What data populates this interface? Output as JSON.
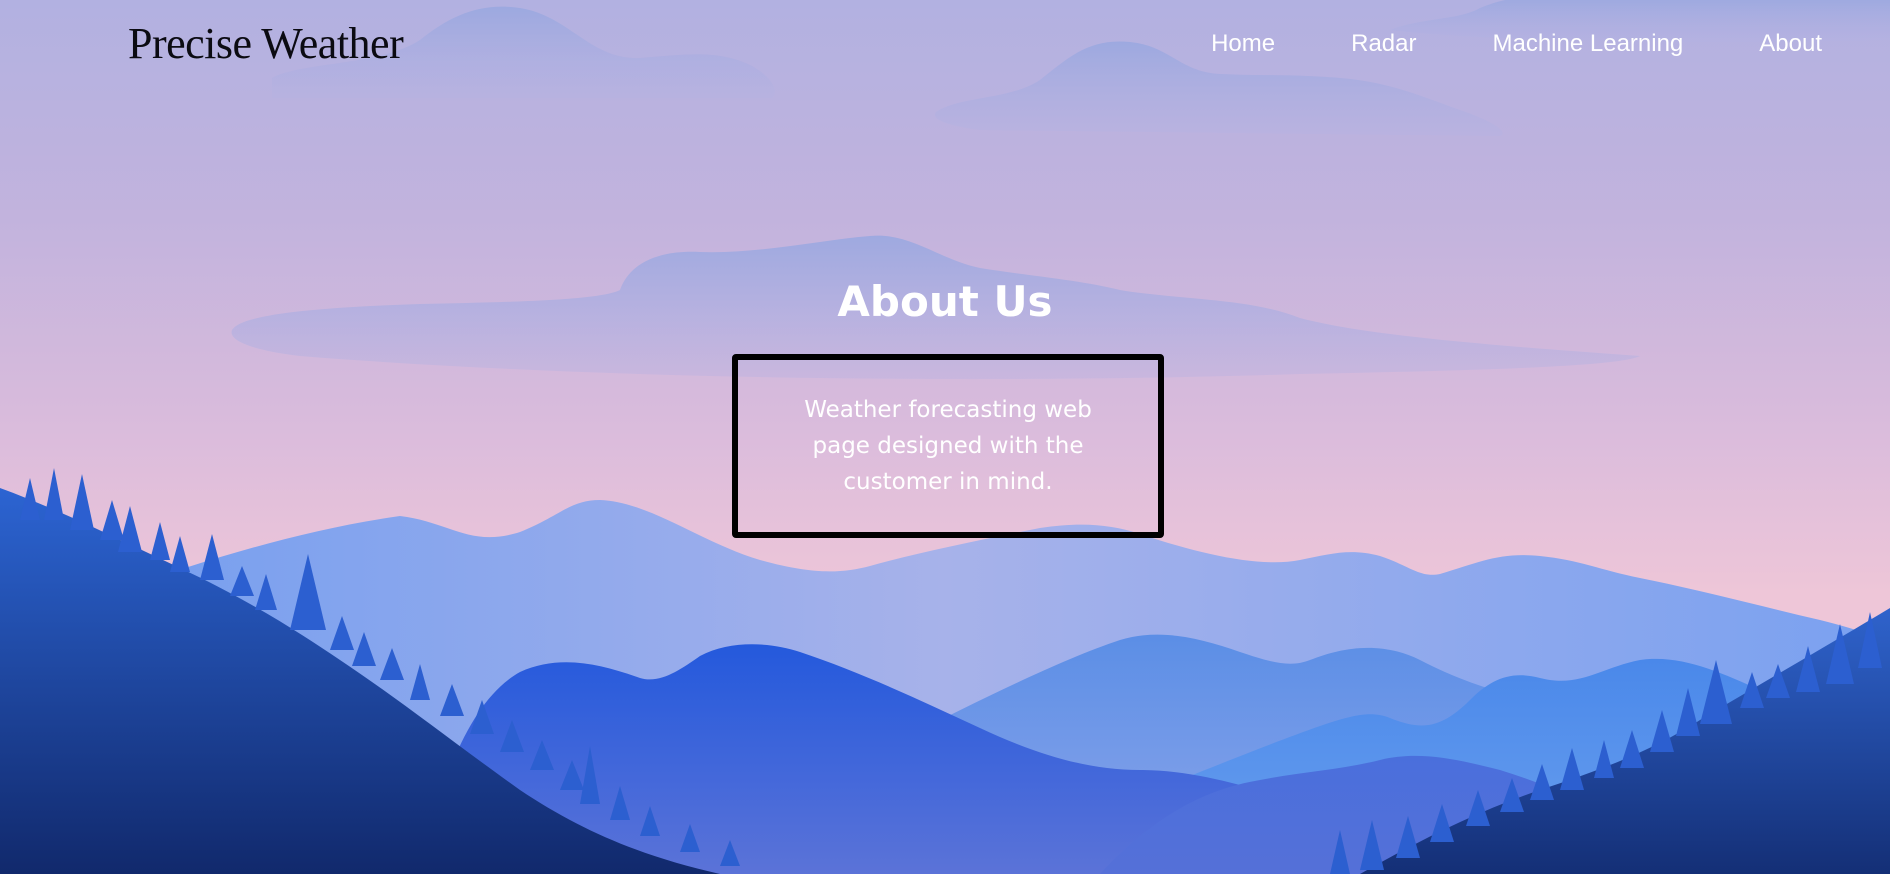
{
  "header": {
    "brand": "Precise Weather",
    "nav": [
      {
        "label": "Home"
      },
      {
        "label": "Radar"
      },
      {
        "label": "Machine Learning"
      },
      {
        "label": "About"
      }
    ]
  },
  "main": {
    "title": "About Us",
    "description": "Weather forecasting web page designed with the customer in mind."
  },
  "colors": {
    "sky_top": "#b2b1e1",
    "sky_bottom": "#eec6d8",
    "mountain_light": "#7ea6f2",
    "mountain_mid": "#4a86e8",
    "mountain_dark": "#2a5bd6",
    "forest_dark": "#12307a",
    "text_light": "#ffffff",
    "brand_text": "#0b0b12",
    "box_border": "#000000"
  }
}
